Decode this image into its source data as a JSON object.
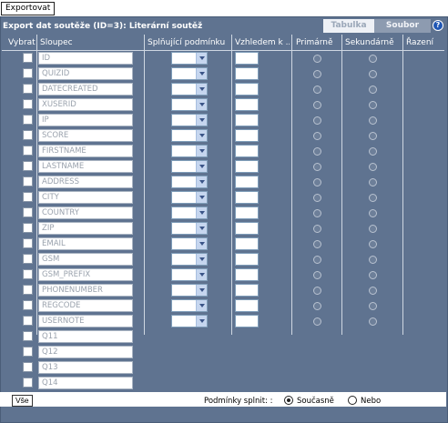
{
  "toolbar": {
    "export_label": "Exportovat"
  },
  "title": "Export dat soutěže (ID=3): Literární soutěž",
  "tabs": [
    {
      "label": "Tabulka",
      "active": true
    },
    {
      "label": "Soubor",
      "active": false
    }
  ],
  "help_glyph": "?",
  "headers": {
    "select": "Vybrat",
    "column": "Sloupec",
    "condition": "Splňující podmínku",
    "relative": "Vzhledem k ...",
    "primary": "Primárně",
    "secondary": "Sekundárně",
    "sort": "Řazení"
  },
  "rows": [
    {
      "name": "ID",
      "has_filters": true
    },
    {
      "name": "QUIZID",
      "has_filters": true
    },
    {
      "name": "DATECREATED",
      "has_filters": true
    },
    {
      "name": "XUSERID",
      "has_filters": true
    },
    {
      "name": "IP",
      "has_filters": true
    },
    {
      "name": "SCORE",
      "has_filters": true
    },
    {
      "name": "FIRSTNAME",
      "has_filters": true
    },
    {
      "name": "LASTNAME",
      "has_filters": true
    },
    {
      "name": "ADDRESS",
      "has_filters": true
    },
    {
      "name": "CITY",
      "has_filters": true
    },
    {
      "name": "COUNTRY",
      "has_filters": true
    },
    {
      "name": "ZIP",
      "has_filters": true
    },
    {
      "name": "EMAIL",
      "has_filters": true
    },
    {
      "name": "GSM",
      "has_filters": true
    },
    {
      "name": "GSM_PREFIX",
      "has_filters": true
    },
    {
      "name": "PHONENUMBER",
      "has_filters": true
    },
    {
      "name": "REGCODE",
      "has_filters": true
    },
    {
      "name": "USERNOTE",
      "has_filters": true
    },
    {
      "name": "Q11",
      "has_filters": false
    },
    {
      "name": "Q12",
      "has_filters": false
    },
    {
      "name": "Q13",
      "has_filters": false
    },
    {
      "name": "Q14",
      "has_filters": false
    }
  ],
  "footer": {
    "select_all_label": "Vše",
    "conditions_label": "Podmínky splnit: :",
    "option_and": "Současně",
    "option_or": "Nebo",
    "selected": "Současně"
  },
  "colors": {
    "panel": "#5f7390",
    "help": "#1f56b4"
  }
}
